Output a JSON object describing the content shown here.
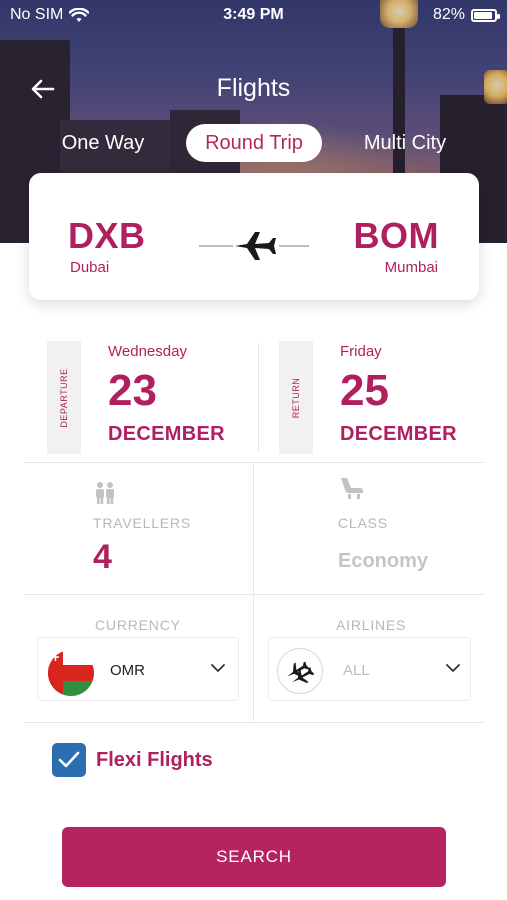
{
  "status_bar": {
    "carrier": "No SIM",
    "time": "3:49 PM",
    "battery": "82%",
    "battery_level": 0.82
  },
  "header": {
    "title": "Flights",
    "back_icon": "arrow-left-icon"
  },
  "trip_tabs": [
    {
      "label": "One Way",
      "selected": false
    },
    {
      "label": "Round Trip",
      "selected": true
    },
    {
      "label": "Multi City",
      "selected": false
    }
  ],
  "route": {
    "from_code": "DXB",
    "from_city": "Dubai",
    "to_code": "BOM",
    "to_city": "Mumbai",
    "icon": "airplane-icon"
  },
  "departure": {
    "tab_label": "DEPARTURE",
    "weekday": "Wednesday",
    "day": "23",
    "month": "DECEMBER"
  },
  "return": {
    "tab_label": "RETURN",
    "weekday": "Friday",
    "day": "25",
    "month": "DECEMBER"
  },
  "travellers": {
    "label": "TRAVELLERS",
    "count": "4",
    "icon": "travellers-icon"
  },
  "class": {
    "label": "CLASS",
    "value": "Economy",
    "icon": "seat-icon"
  },
  "currency": {
    "label": "CURRENCY",
    "value": "OMR",
    "flag_icon": "oman-flag-icon"
  },
  "airlines": {
    "label": "AIRLINES",
    "value": "ALL",
    "icon": "airlines-icon"
  },
  "flexi": {
    "label": "Flexi Flights",
    "checked": true
  },
  "search_button": {
    "label": "SEARCH"
  },
  "colors": {
    "brand": "#b01f5e",
    "button": "#b52461",
    "checkbox": "#2c6eb0"
  }
}
